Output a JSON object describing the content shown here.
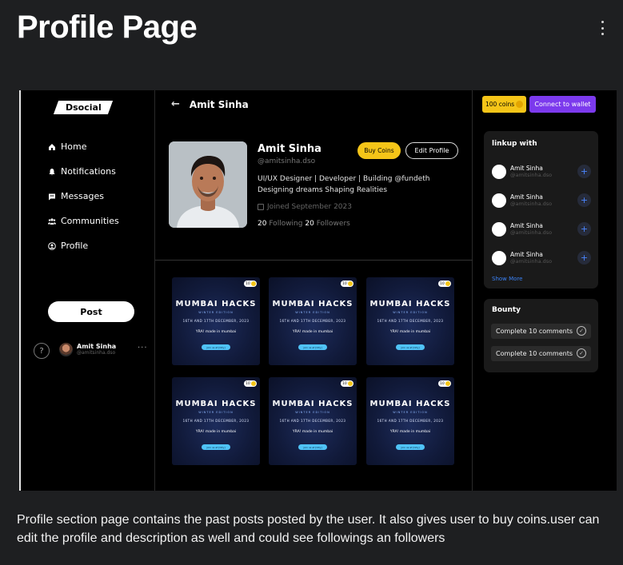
{
  "header": {
    "title": "Profile Page"
  },
  "caption": "Profile section page contains the past posts posted by the user. It also gives user to buy coins.user can edit the profile and description as well and could see followings an followers",
  "app": {
    "logo": "Dsocial",
    "nav": [
      {
        "label": "Home",
        "icon": "home-icon"
      },
      {
        "label": "Notifications",
        "icon": "bell-icon"
      },
      {
        "label": "Messages",
        "icon": "message-icon"
      },
      {
        "label": "Communities",
        "icon": "users-icon"
      },
      {
        "label": "Profile",
        "icon": "user-circle-icon"
      }
    ],
    "post_button": "Post",
    "help": "?",
    "current_user": {
      "name": "Amit Sinha",
      "handle": "@amitsinha.dso"
    },
    "more": "..."
  },
  "profile": {
    "back_title": "Amit Sinha",
    "name": "Amit Sinha",
    "handle": "@amitsinha.dso",
    "bio_line1": "UI/UX Designer | Developer | Building @fundeth",
    "bio_line2": "Designing dreams Shaping Realities",
    "joined": "Joined September 2023",
    "following_count": "20",
    "following_label": "Following",
    "followers_count": "20",
    "followers_label": "Followers",
    "buy_coins": "Buy Coins",
    "edit_profile": "Edit Profile"
  },
  "posts": [
    {
      "badge": "10",
      "title": "MUMBAI HACKS",
      "subtitle": "WINTER EDITION",
      "date": "16TH AND 17TH DECEMBER, 2023",
      "venue": "YRA!  made in mumbai",
      "cta": "Join us at [City]"
    },
    {
      "badge": "10",
      "title": "MUMBAI HACKS",
      "subtitle": "WINTER EDITION",
      "date": "16TH AND 17TH DECEMBER, 2023",
      "venue": "YRA!  made in mumbai",
      "cta": "Join us at [City]"
    },
    {
      "badge": "10",
      "title": "MUMBAI HACKS",
      "subtitle": "WINTER EDITION",
      "date": "16TH AND 17TH DECEMBER, 2023",
      "venue": "YRA!  made in mumbai",
      "cta": "Join us at [City]"
    },
    {
      "badge": "10",
      "title": "MUMBAI HACKS",
      "subtitle": "WINTER EDITION",
      "date": "16TH AND 17TH DECEMBER, 2023",
      "venue": "YRA!  made in mumbai",
      "cta": "Join us at [City]"
    },
    {
      "badge": "10",
      "title": "MUMBAI HACKS",
      "subtitle": "WINTER EDITION",
      "date": "16TH AND 17TH DECEMBER, 2023",
      "venue": "YRA!  made in mumbai",
      "cta": "Join us at [City]"
    },
    {
      "badge": "10",
      "title": "MUMBAI HACKS",
      "subtitle": "WINTER EDITION",
      "date": "16TH AND 17TH DECEMBER, 2023",
      "venue": "YRA!  made in mumbai",
      "cta": "Join us at [City]"
    }
  ],
  "right": {
    "coins": "100 coins",
    "connect_wallet": "Connect to wallet",
    "linkup_title": "linkup with",
    "linkup": [
      {
        "name": "Amit Sinha",
        "handle": "@amitsinha.dso",
        "action": "+"
      },
      {
        "name": "Amit Sinha",
        "handle": "@amitsinha.dso",
        "action": "+"
      },
      {
        "name": "Amit Sinha",
        "handle": "@amitsinha.dso",
        "action": "+"
      },
      {
        "name": "Amit Sinha",
        "handle": "@amitsinha.dso",
        "action": "+"
      }
    ],
    "show_more": "Show More",
    "bounty_title": "Bounty",
    "bounty": [
      {
        "label": "Complete 10 comments",
        "check": "✓"
      },
      {
        "label": "Complete 10 comments",
        "check": "✓"
      }
    ]
  },
  "colors": {
    "accent_yellow": "#f5c518",
    "wallet_purple": "#7c3aed",
    "link_blue": "#3b82f6"
  }
}
